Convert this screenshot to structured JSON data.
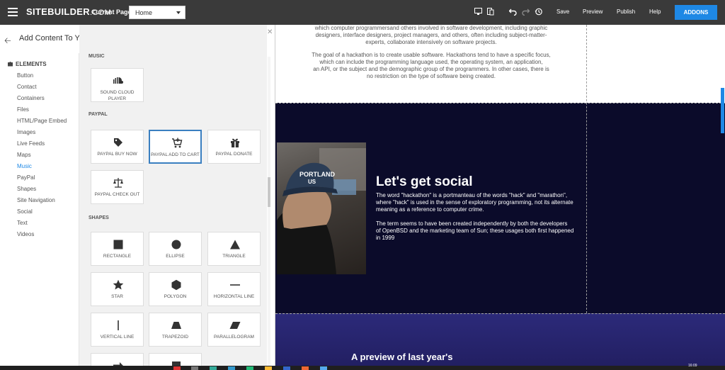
{
  "topbar": {
    "brand_main": "SITEBUILDER",
    "brand_suffix": ".COM",
    "current_page_label": "Current Page:",
    "current_page_value": "Home",
    "save": "Save",
    "preview": "Preview",
    "publish": "Publish",
    "help": "Help",
    "addons": "ADDONS"
  },
  "panel": {
    "title": "Add Content To Your Website",
    "search_value": "",
    "categories_header": "ELEMENTS",
    "categories": [
      "Button",
      "Contact",
      "Containers",
      "Files",
      "HTML/Page Embed",
      "Images",
      "Live Feeds",
      "Maps",
      "Music",
      "PayPal",
      "Shapes",
      "Site Navigation",
      "Social",
      "Text",
      "Videos"
    ],
    "active_category": "Music",
    "sections": {
      "music": {
        "title": "MUSIC",
        "items": [
          {
            "label": "SOUND CLOUD PLAYER",
            "icon": "soundcloud-icon"
          }
        ]
      },
      "paypal": {
        "title": "PAYPAL",
        "items": [
          {
            "label": "PAYPAL BUY NOW",
            "icon": "tag-icon"
          },
          {
            "label": "PAYPAL ADD TO CART",
            "icon": "cart-icon"
          },
          {
            "label": "PAYPAL DONATE",
            "icon": "gift-icon"
          },
          {
            "label": "PAYPAL CHECK OUT",
            "icon": "scales-icon"
          }
        ]
      },
      "shapes": {
        "title": "SHAPES",
        "items": [
          {
            "label": "RECTANGLE",
            "icon": "rectangle-icon"
          },
          {
            "label": "ELLIPSE",
            "icon": "ellipse-icon"
          },
          {
            "label": "TRIANGLE",
            "icon": "triangle-icon"
          },
          {
            "label": "STAR",
            "icon": "star-icon"
          },
          {
            "label": "POLYGON",
            "icon": "polygon-icon"
          },
          {
            "label": "HORIZONTAL LINE",
            "icon": "horizontal-line-icon"
          },
          {
            "label": "VERTICAL LINE",
            "icon": "vertical-line-icon"
          },
          {
            "label": "TRAPEZOID",
            "icon": "trapezoid-icon"
          },
          {
            "label": "PARALLELOGRAM",
            "icon": "parallelogram-icon"
          }
        ]
      }
    }
  },
  "canvas": {
    "intro_lines": [
      "which computer programmersand others involved in software development, including graphic",
      "designers, interface designers, project managers, and others, often including subject-matter-",
      "experts, collaborate intensively on software projects."
    ],
    "goal_lines": [
      "The goal of a hackathon is to create usable software. Hackathons tend to have a specific focus,",
      "which can include the programming language used, the operating system, an application,",
      "an API, or the subject and the demographic group of the programmers. In other cases, there is",
      "no restriction on the type of software being created."
    ],
    "social_title": "Let's get social",
    "social_p1": [
      "The word \"hackathon\" is a portmanteau of the words \"hack\" and \"marathon\",",
      "where \"hack\" is used in the sense of exploratory programming, not its alternate",
      "meaning as a reference to computer crime."
    ],
    "social_p2": [
      "The term seems to have been created independently by both the developers",
      "of OpenBSD and the marketing team of Sun; these usages both first happened",
      "in 1999"
    ],
    "cap_text": [
      "PORTLAND",
      "US"
    ],
    "preview_heading": "A preview of last year's"
  },
  "taskbar": {
    "clock": "16:09"
  },
  "colors": {
    "accent": "#1e88e5",
    "topbar": "#3a3a3a",
    "dark_section": "#0b0b2a",
    "purple_section": "#2c2a7a"
  }
}
